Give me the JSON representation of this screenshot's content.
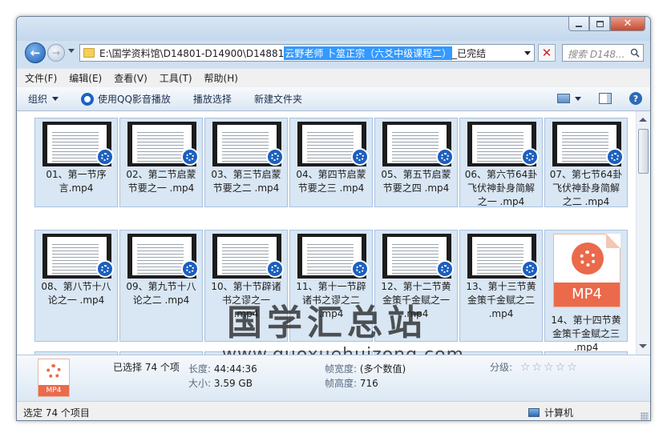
{
  "address": {
    "prefix": "E:\\国学资料馆\\D14801-D14900\\D14881",
    "selected": "云野老师 卜筮正宗（六爻中级课程二）",
    "suffix": "_已完结"
  },
  "search": {
    "placeholder": "搜索 D148..."
  },
  "menu": [
    "文件(F)",
    "编辑(E)",
    "查看(V)",
    "工具(T)",
    "帮助(H)"
  ],
  "toolbar": {
    "organize": "组织",
    "play_qq": "使用QQ影音播放",
    "play_select": "播放选择",
    "new_folder": "新建文件夹"
  },
  "files": [
    "01、第一节序言.mp4",
    "02、第二节启蒙节要之一 .mp4",
    "03、第三节启蒙节要之二 .mp4",
    "04、第四节启蒙节要之三 .mp4",
    "05、第五节启蒙节要之四 .mp4",
    "06、第六节64卦飞伏神卦身简解之一 .mp4",
    "07、第七节64卦飞伏神卦身简解之二 .mp4",
    "08、第八节十八论之一 .mp4",
    "09、第九节十八论之二 .mp4",
    "10、第十节辟诸书之谬之一 .mp4",
    "11、第十一节辟诸书之谬之二 .mp4",
    "12、第十二节黄金策千金赋之一 .mp4",
    "13、第十三节黄金策千金赋之二 .mp4",
    "14、第十四节黄金策千金赋之三 .mp4"
  ],
  "file_badge": "MP4",
  "watermark": {
    "title": "国学汇总站",
    "url": "www.guoxuehuizong.com"
  },
  "details": {
    "selected": "已选择 74 个项",
    "length_label": "长度:",
    "length": "44:44:36",
    "size_label": "大小:",
    "size": "3.59 GB",
    "frame_width_label": "帧宽度:",
    "frame_width": "(多个数值)",
    "frame_height_label": "帧高度:",
    "frame_height": "716",
    "rating_label": "分级:",
    "rating": 0,
    "file_badge": "MP4"
  },
  "status": {
    "left": "选定 74 个项目",
    "right": "计算机"
  }
}
